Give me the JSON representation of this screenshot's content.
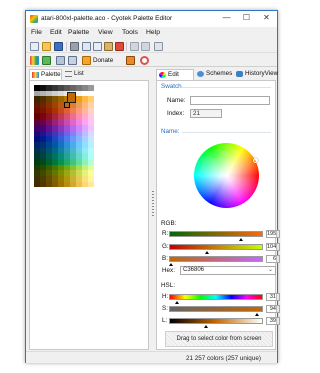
{
  "window": {
    "title": "atari-800xl-palette.aco - Cyotek Palette Editor",
    "minimize": "—",
    "maximize": "☐",
    "close": "✕"
  },
  "menu": [
    "File",
    "Edit",
    "Palette",
    "View",
    "Tools",
    "Help"
  ],
  "toolbar2": {
    "donate_label": "Donate"
  },
  "left_tabs": [
    "Palette",
    "List"
  ],
  "right_tabs": [
    "Edit Color",
    "Schemes",
    "HistoryView"
  ],
  "palette": {
    "selected_color": "#C36806",
    "rows": [
      [
        "#000000",
        "#101010",
        "#252525",
        "#353535",
        "#464646",
        "#575757",
        "#666666",
        "#767676",
        "#858585",
        "#999999"
      ],
      [
        "#A6A6A6",
        "#B3B3B3",
        "#C0C0C0",
        "#CECECE",
        "#DADADA",
        "#E6E6E6",
        "#F0F0F0",
        "#F8F8F8",
        "#FFFFFF",
        "#FFFFFF"
      ],
      [
        "#3A2600",
        "#4C3000",
        "#664200",
        "#805400",
        "#996600",
        "#B37800",
        "#CC8B00",
        "#E6A21A",
        "#FFB940",
        "#FFCF70"
      ],
      [
        "#5C1A00",
        "#6E2400",
        "#853300",
        "#9E4500",
        "#B85812",
        "#C36806",
        "#D98233",
        "#EE9D55",
        "#FFB878",
        "#FFD2A0"
      ],
      [
        "#6A0C00",
        "#7B1500",
        "#922200",
        "#AA3400",
        "#C44A1A",
        "#DC6333",
        "#F07F52",
        "#FF9B74",
        "#FFB89A",
        "#FFD3C1"
      ],
      [
        "#660000",
        "#780510",
        "#8F1224",
        "#A8243A",
        "#C13955",
        "#D85173",
        "#EE6D92",
        "#FF8BB1",
        "#FFA9CC",
        "#FFC9E2"
      ],
      [
        "#5A0038",
        "#6A0048",
        "#80105E",
        "#982278",
        "#B13694",
        "#C94DB0",
        "#DE67CC",
        "#F084E3",
        "#FFA3F4",
        "#FFC2FF"
      ],
      [
        "#3C0066",
        "#4A0078",
        "#5E108E",
        "#7322A6",
        "#8A37BF",
        "#A04FD8",
        "#B86AED",
        "#CC87FF",
        "#DDA6FF",
        "#ECC6FF"
      ],
      [
        "#1A0A78",
        "#24138C",
        "#3322A2",
        "#4535B8",
        "#5A4ACE",
        "#7062E2",
        "#8A7EF4",
        "#A59CFF",
        "#C0BBFF",
        "#DAD8FF"
      ],
      [
        "#000E7A",
        "#001A90",
        "#0B2DA8",
        "#1F45C0",
        "#355FD8",
        "#4E7BEE",
        "#6A98FF",
        "#89B4FF",
        "#AACFFF",
        "#C9E6FF"
      ],
      [
        "#002468",
        "#003078",
        "#00438E",
        "#0058A6",
        "#1472BE",
        "#2E8ED6",
        "#4BACEC",
        "#6CC8FF",
        "#90DFFF",
        "#B6F0FF"
      ],
      [
        "#00304C",
        "#003E5C",
        "#005270",
        "#006886",
        "#10819E",
        "#2B9CB6",
        "#49B8CE",
        "#6AD3E4",
        "#8FEBF6",
        "#B6FAFF"
      ],
      [
        "#00372C",
        "#00473A",
        "#005C4C",
        "#007260",
        "#0A8B78",
        "#25A590",
        "#42BFAA",
        "#62D8C4",
        "#86EEDC",
        "#AEFFF2"
      ],
      [
        "#003A10",
        "#004A1A",
        "#006028",
        "#00783A",
        "#0A914E",
        "#25AA66",
        "#43C380",
        "#65DC9C",
        "#8BF2BA",
        "#B4FFD8"
      ],
      [
        "#1E3A00",
        "#284A00",
        "#366000",
        "#467800",
        "#5A9100",
        "#70AA12",
        "#8AC330",
        "#A6DC52",
        "#C3F276",
        "#DEFF9E"
      ],
      [
        "#333800",
        "#414800",
        "#545E00",
        "#687600",
        "#7F8E00",
        "#98A712",
        "#B2C030",
        "#CDDA52",
        "#E6F176",
        "#FAFF9E"
      ],
      [
        "#3C3000",
        "#4C3E00",
        "#625000",
        "#7A6600",
        "#947E00",
        "#AE9812",
        "#C8B230",
        "#E2CC52",
        "#F8E476",
        "#FFF59E"
      ],
      [
        "#422A00",
        "#533600",
        "#6A4700",
        "#845C00",
        "#9E7300",
        "#B88C12",
        "#D2A630",
        "#EAC052",
        "#FFD676",
        "#FFE89E"
      ]
    ]
  },
  "edit_color": {
    "swatch_heading": "Swatch",
    "name_label": "Name:",
    "name_value": "",
    "index_label": "Index:",
    "index_value": "21",
    "name_heading": "Name:",
    "rgb_heading": "RGB:",
    "r_label": "R:",
    "r_value": "195",
    "r_level": 0.765,
    "g_label": "G:",
    "g_value": "104",
    "g_level": 0.408,
    "b_label": "B:",
    "b_value": "6",
    "b_level": 0.024,
    "hex_label": "Hex:",
    "hex_value": "C36806",
    "hsl_heading": "HSL:",
    "h_label": "H:",
    "h_value": "31",
    "h_level": 0.086,
    "s_label": "S:",
    "s_value": "94",
    "s_level": 0.94,
    "l_label": "L:",
    "l_value": "39",
    "l_level": 0.39,
    "drag_text": "Drag to select color from screen"
  },
  "status": {
    "text": "21   257 colors (257 unique)"
  },
  "colors": {
    "accent": "#2A6EBD",
    "window_border": "#2B79C4",
    "current": "#C36806"
  },
  "icons": {
    "toolbar": [
      "new-icon",
      "open-icon",
      "save-icon",
      "print-icon",
      "cut-icon",
      "copy-icon",
      "paste-icon",
      "delete-icon",
      "undo-icon",
      "redo-icon",
      "more-icon"
    ],
    "toolbar2": [
      "palette-icon",
      "add-icon",
      "grid-icon",
      "list-icon",
      "donate-icon",
      "image-icon",
      "loop-icon"
    ]
  }
}
